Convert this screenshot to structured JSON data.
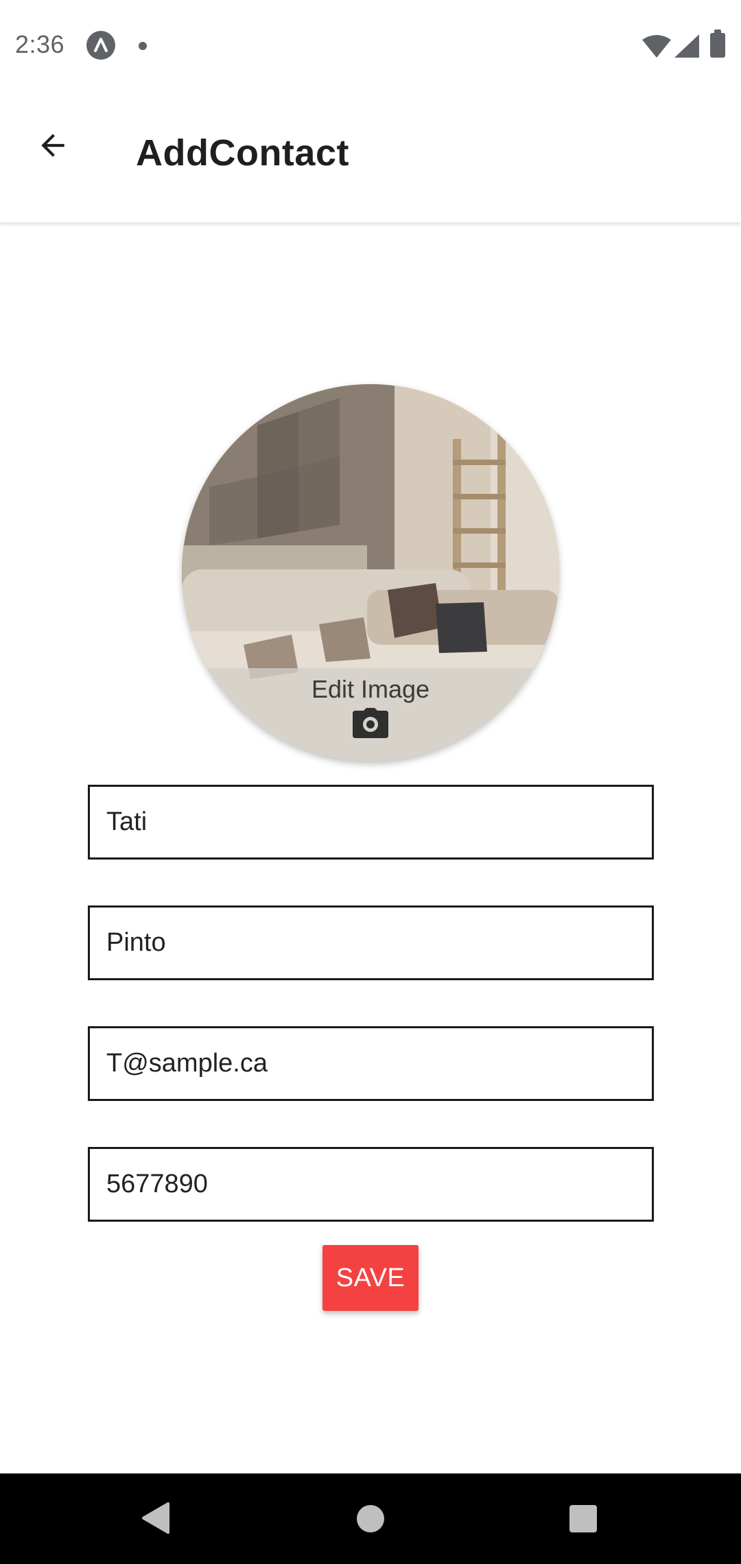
{
  "status_bar": {
    "time": "2:36",
    "icons": [
      "app-notification-icon",
      "dot-icon",
      "wifi-icon",
      "signal-icon",
      "battery-icon"
    ]
  },
  "app_bar": {
    "title": "AddContact",
    "back_icon": "arrow-back-icon"
  },
  "avatar": {
    "edit_label": "Edit Image",
    "edit_icon": "camera-icon"
  },
  "form": {
    "first_name": {
      "value": "Tati"
    },
    "last_name": {
      "value": "Pinto"
    },
    "email": {
      "value": "T@sample.ca"
    },
    "phone": {
      "value": "5677890"
    }
  },
  "save_button": {
    "label": "SAVE",
    "color": "#f44242"
  },
  "nav_bar": {
    "icons": [
      "nav-back-icon",
      "nav-home-icon",
      "nav-recent-apps-icon"
    ]
  }
}
